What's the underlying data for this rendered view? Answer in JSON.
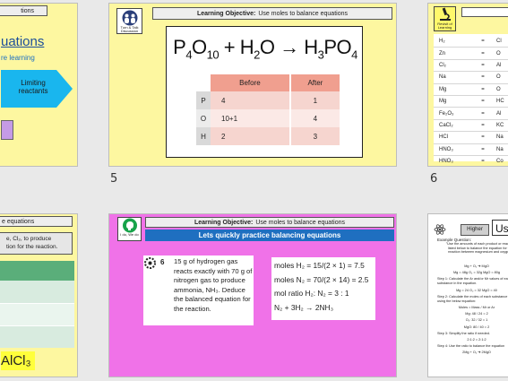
{
  "slides": [
    {
      "lo_fragment": "tions",
      "title_fragment": "uations",
      "sub_fragment": "re learning",
      "arrow_text": "Limiting reactants",
      "colors": {
        "bg": "#fdf7a0",
        "arrow": "#19b6ee",
        "box": "#c59be6"
      }
    },
    {
      "number": "5",
      "lo_label": "Learning Objective:",
      "lo_text": "Use moles to balance equations",
      "icon_name": "turn-and-talk-icon",
      "icon_caption": "Turn & Talk Discussion",
      "equation": {
        "p_sub": "4",
        "o_sub": "10",
        "plus": "+",
        "h2o_sub": "2",
        "arrow": "→",
        "h3_sub": "3",
        "o4_sub": "4"
      },
      "table": {
        "headers": [
          "Before",
          "After"
        ],
        "rows": [
          {
            "el": "P",
            "before": "4",
            "after": "1"
          },
          {
            "el": "O",
            "before": "10+1",
            "after": "4"
          },
          {
            "el": "H",
            "before": "2",
            "after": "3"
          }
        ]
      },
      "colors": {
        "bg": "#fdf7a0",
        "header": "#f09f8f",
        "row_el": "#d9d9d9",
        "row_a": "#f6d5cf",
        "row_b": "#fbe9e6"
      }
    },
    {
      "number": "6",
      "icon_name": "microscope-icon",
      "icon_caption": "Revisit of Learning",
      "rows": [
        [
          "H₂",
          "=",
          "Cl"
        ],
        [
          "Zn",
          "=",
          "O"
        ],
        [
          "Cl₂",
          "=",
          "Al"
        ],
        [
          "Na",
          "=",
          "O"
        ],
        [
          "Mg",
          "=",
          "O"
        ],
        [
          "Mg",
          "=",
          "HC"
        ],
        [
          "Fe₂O₃",
          "=",
          "Al"
        ],
        [
          "CaCl₂",
          "=",
          "KC"
        ],
        [
          "HCl",
          "=",
          "Na"
        ],
        [
          "HNO₃",
          "=",
          "Na"
        ],
        [
          "HNO₃",
          "=",
          "Co"
        ]
      ]
    },
    {
      "lo_fragment": "e equations",
      "task_line1": "e, Cl₂, to produce",
      "task_line2": "tion for the reaction.",
      "answer": "AlCl₃",
      "colors": {
        "bg": "#fdf7a0",
        "green_dark": "#5aae7a",
        "green_light": "#d8ebdf",
        "answer_bg": "#ffff3b"
      }
    },
    {
      "lo_label": "Learning Objective:",
      "lo_text": "Use moles to balance equations",
      "icon_name": "brain-icon",
      "icon_caption": "I do, We do",
      "banner": "Lets quickly practice balancing equations",
      "question_number": "6",
      "question_icon": "gear-icon",
      "question_text": "15 g of hydrogen gas reacts exactly with 70 g of nitrogen gas to produce ammonia, NH₃. Deduce the balanced equation for the reaction.",
      "answers": [
        "moles H₂ = 15/(2 × 1) = 7.5",
        "moles N₂ = 70/(2 × 14) = 2.5",
        "mol ratio H₂: N₂ = 3 : 1",
        "N₂ + 3H₂ → 2NH₃"
      ],
      "colors": {
        "bg": "#f072e8",
        "banner": "#1f6fc0"
      }
    },
    {
      "icon_name": "atom-icon",
      "tag": "Higher",
      "title_fragment": "Usin",
      "example_heading": "Example Question:",
      "quote": "\"Use the amounts of each product or reactant listed below to balance the equation for the reaction between magnesium and oxygen\"",
      "lines": [
        "Mg + O₂ ➔ MgO",
        "Mg = 48g    O₂ = 32g    MgO = 80g",
        "Step 1: Calculate the Ar and/or Mr values of each substance in the equation.",
        "Mg = 24    O₂ = 32    MgO = 40",
        "Step 2: Calculate the moles of each substance using the below equation:",
        "Moles = Mass / Mr or Ar",
        "Mg: 48 / 24 = 2",
        "O₂: 32 / 32 = 1",
        "MgO: 80 / 40 = 2",
        "Step 3: Simplify the ratio if needed.",
        "2:1:2 = 2:1:2",
        "Step 4: Use the ratio to balance the equation",
        "2Mg + O₂ ➔ 2MgO"
      ],
      "colors": {
        "tag_bg": "#cfcfcf",
        "title_border": "#333333"
      }
    }
  ]
}
